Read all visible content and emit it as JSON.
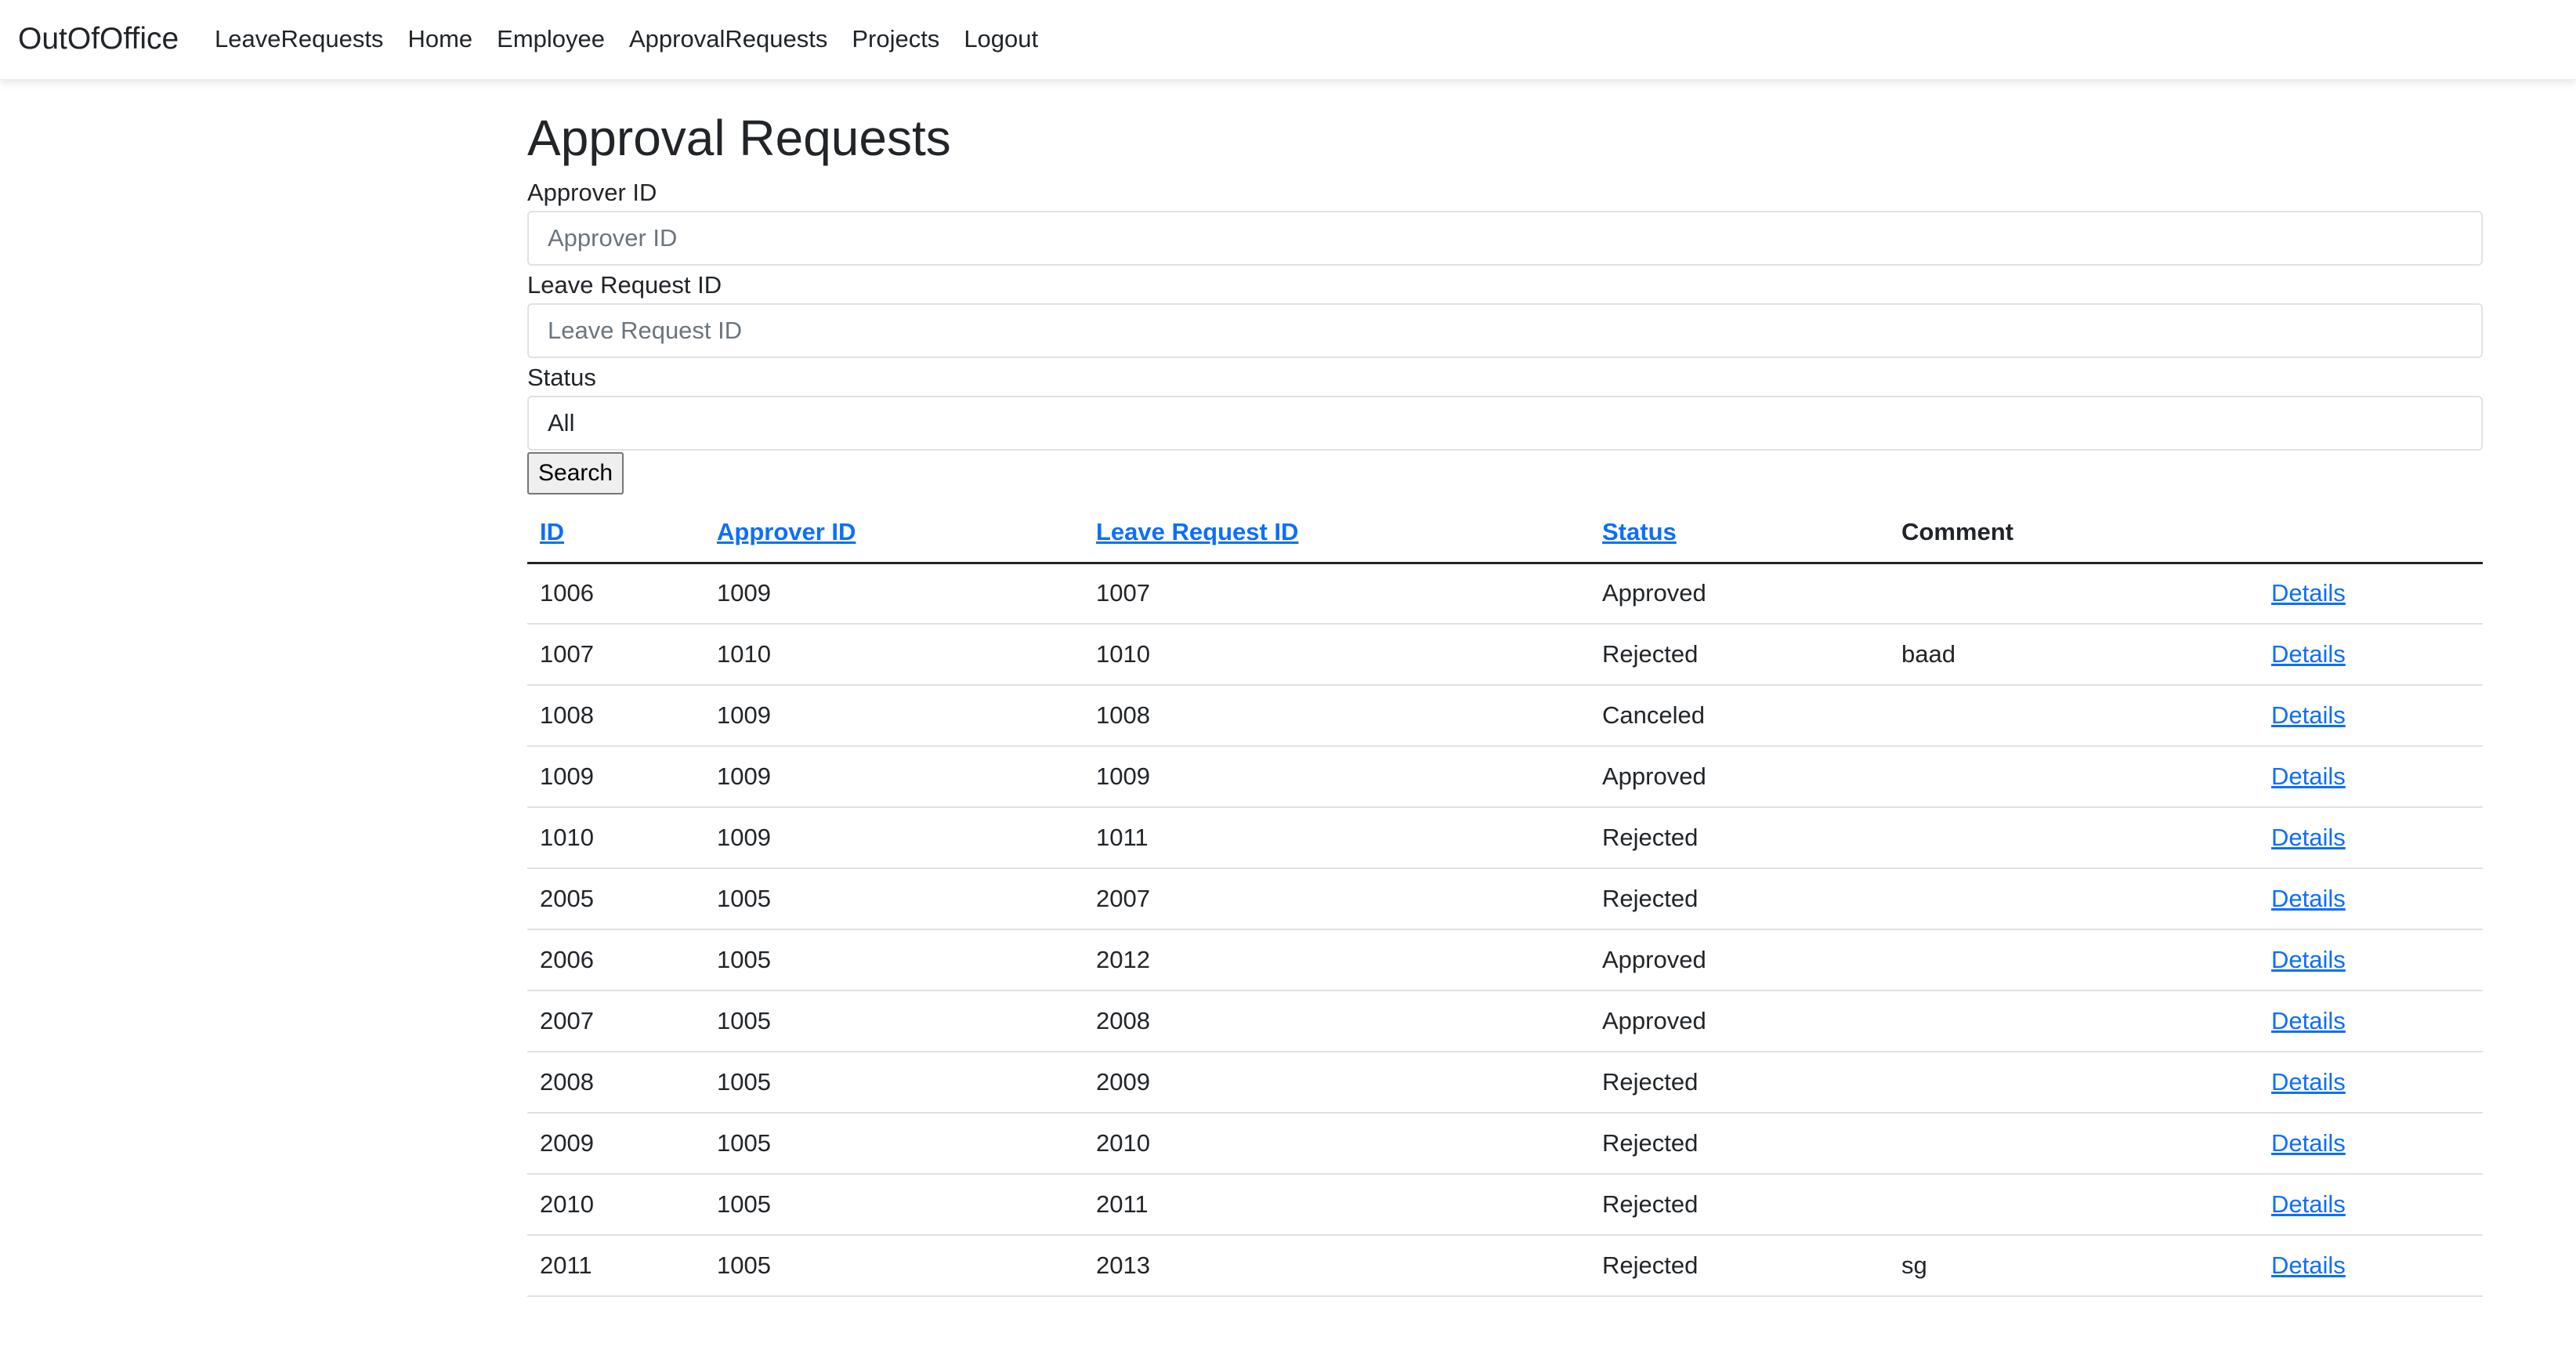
{
  "navbar": {
    "brand": "OutOfOffice",
    "links": [
      "LeaveRequests",
      "Home",
      "Employee",
      "ApprovalRequests",
      "Projects",
      "Logout"
    ]
  },
  "page": {
    "title": "Approval Requests"
  },
  "filters": {
    "approver_label": "Approver ID",
    "approver_placeholder": "Approver ID",
    "approver_value": "",
    "leave_label": "Leave Request ID",
    "leave_placeholder": "Leave Request ID",
    "leave_value": "",
    "status_label": "Status",
    "status_selected": "All",
    "search_label": "Search"
  },
  "table": {
    "headers": {
      "id": "ID",
      "approver_id": "Approver ID",
      "leave_request_id": "Leave Request ID",
      "status": "Status",
      "comment": "Comment"
    },
    "action_label": "Details",
    "rows": [
      {
        "id": "1006",
        "approver_id": "1009",
        "leave_request_id": "1007",
        "status": "Approved",
        "comment": ""
      },
      {
        "id": "1007",
        "approver_id": "1010",
        "leave_request_id": "1010",
        "status": "Rejected",
        "comment": "baad"
      },
      {
        "id": "1008",
        "approver_id": "1009",
        "leave_request_id": "1008",
        "status": "Canceled",
        "comment": ""
      },
      {
        "id": "1009",
        "approver_id": "1009",
        "leave_request_id": "1009",
        "status": "Approved",
        "comment": ""
      },
      {
        "id": "1010",
        "approver_id": "1009",
        "leave_request_id": "1011",
        "status": "Rejected",
        "comment": ""
      },
      {
        "id": "2005",
        "approver_id": "1005",
        "leave_request_id": "2007",
        "status": "Rejected",
        "comment": ""
      },
      {
        "id": "2006",
        "approver_id": "1005",
        "leave_request_id": "2012",
        "status": "Approved",
        "comment": ""
      },
      {
        "id": "2007",
        "approver_id": "1005",
        "leave_request_id": "2008",
        "status": "Approved",
        "comment": ""
      },
      {
        "id": "2008",
        "approver_id": "1005",
        "leave_request_id": "2009",
        "status": "Rejected",
        "comment": ""
      },
      {
        "id": "2009",
        "approver_id": "1005",
        "leave_request_id": "2010",
        "status": "Rejected",
        "comment": ""
      },
      {
        "id": "2010",
        "approver_id": "1005",
        "leave_request_id": "2011",
        "status": "Rejected",
        "comment": ""
      },
      {
        "id": "2011",
        "approver_id": "1005",
        "leave_request_id": "2013",
        "status": "Rejected",
        "comment": "sg"
      }
    ]
  },
  "colors": {
    "link": "#0d6efd",
    "text": "#212529",
    "border": "#dee2e6"
  }
}
